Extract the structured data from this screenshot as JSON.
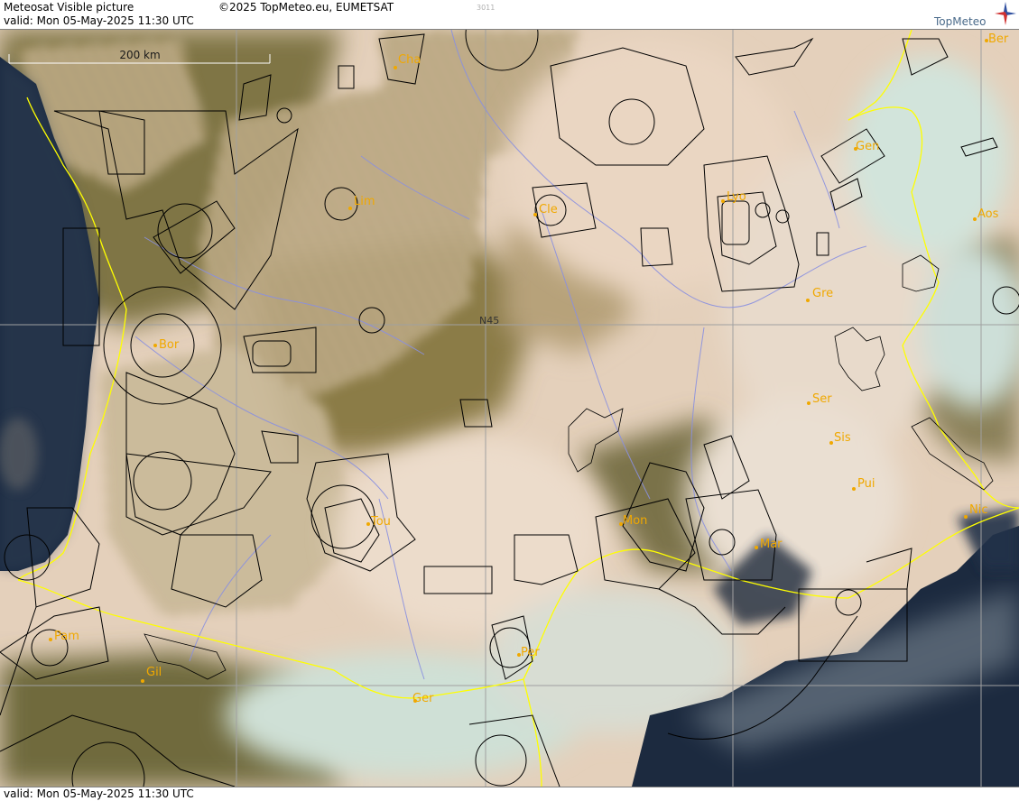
{
  "header": {
    "title": "Meteosat Visible picture",
    "copyright": "©2025 TopMeteo.eu, EUMETSAT",
    "code": "3011",
    "valid": "valid:  Mon  05-May-2025  11:30 UTC",
    "logo_text": "TopMeteo"
  },
  "footer": {
    "valid": "valid:  Mon  05-May-2025  11:30 UTC"
  },
  "scale_bar": {
    "label": "200 km"
  },
  "grid_label": "N45",
  "colors": {
    "ocean": "#1a2a42",
    "land": "#8a7a45",
    "cloud": "#e7d4c0",
    "coast": "#ffff00",
    "river": "#8a90e0",
    "airspace": "#000000",
    "city_label": "#f0a800",
    "grid": "#a0a0a0"
  },
  "cities": [
    {
      "name": "Cha"
    },
    {
      "name": "Lim"
    },
    {
      "name": "Cle"
    },
    {
      "name": "Lyo"
    },
    {
      "name": "Gen"
    },
    {
      "name": "Ber"
    },
    {
      "name": "Aos"
    },
    {
      "name": "Gre"
    },
    {
      "name": "Bor"
    },
    {
      "name": "Ser"
    },
    {
      "name": "Sis"
    },
    {
      "name": "Pui"
    },
    {
      "name": "Nic"
    },
    {
      "name": "Tou"
    },
    {
      "name": "Mon"
    },
    {
      "name": "Mar"
    },
    {
      "name": "Per"
    },
    {
      "name": "Pam"
    },
    {
      "name": "Gil"
    },
    {
      "name": "Ger"
    }
  ]
}
